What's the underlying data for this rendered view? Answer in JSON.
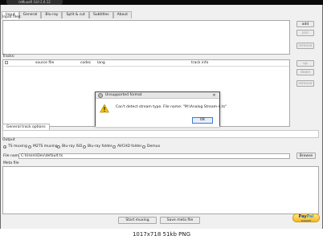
{
  "window": {
    "title": "tsMuxeR GUI 2.6.12"
  },
  "tabs": [
    {
      "label": "Input"
    },
    {
      "label": "General"
    },
    {
      "label": "Blu-ray"
    },
    {
      "label": "Split & cut"
    },
    {
      "label": "Subtitles"
    },
    {
      "label": "About"
    }
  ],
  "input_files": {
    "label": "Input files:"
  },
  "side_buttons": {
    "add": "add",
    "join": "join",
    "remove": "remove",
    "up": "up",
    "down": "down",
    "remove2": "remove"
  },
  "tracks": {
    "label": "Tracks:",
    "columns": [
      "source file",
      "codec",
      "lang",
      "track info"
    ]
  },
  "general_track_options": "General track options",
  "output": {
    "label": "Output",
    "options": [
      {
        "label": "TS muxing",
        "selected": true
      },
      {
        "label": "M2TS muxing",
        "selected": false
      },
      {
        "label": "Blu-ray ISO",
        "selected": false
      },
      {
        "label": "Blu-ray folder",
        "selected": false
      },
      {
        "label": "AVCHD folder",
        "selected": false
      },
      {
        "label": "Demux",
        "selected": false
      }
    ],
    "file_name_label": "File name",
    "file_name_value": "C:\\Users\\Dev\\default.ts",
    "browse_label": "Browse"
  },
  "meta_file": {
    "label": "Meta file"
  },
  "actions": {
    "start_muxing": "Start muxing",
    "save_meta": "Save meta file"
  },
  "paypal": {
    "logo_pay": "Pay",
    "logo_pal": "Pal",
    "sublabel": "DONATE"
  },
  "dialog": {
    "title": "Unsupported format",
    "message": "Can't detect stream type. File name: \"M:\\Analog Stream-4.ts\"",
    "ok_label": "OK"
  },
  "caption": "1017x718 51kb PNG",
  "colors": {
    "dialog_ok_border": "#3a7bd5",
    "warning_triangle": "#f4c20d"
  }
}
